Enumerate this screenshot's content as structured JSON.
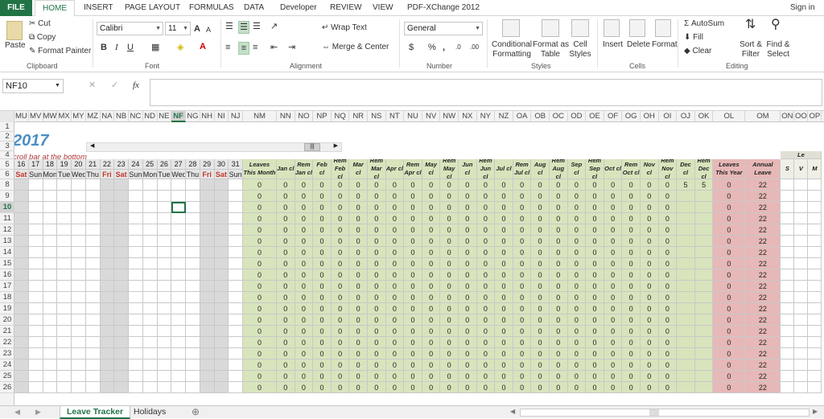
{
  "menu": {
    "tabs": [
      "FILE",
      "HOME",
      "INSERT",
      "PAGE LAYOUT",
      "FORMULAS",
      "DATA",
      "Developer",
      "REVIEW",
      "VIEW",
      "PDF-XChange 2012"
    ],
    "sign_in": "Sign in"
  },
  "ribbon": {
    "clipboard": {
      "paste": "Paste",
      "cut": "Cut",
      "copy": "Copy",
      "format_painter": "Format Painter",
      "group": "Clipboard"
    },
    "font": {
      "name": "Calibri",
      "size": "11",
      "group": "Font",
      "bold": "B",
      "italic": "I",
      "underline": "U",
      "grow": "A",
      "shrink": "A"
    },
    "alignment": {
      "wrap": "Wrap Text",
      "merge": "Merge & Center",
      "group": "Alignment"
    },
    "number": {
      "format": "General",
      "currency": "$",
      "percent": "%",
      "comma": ",",
      "group": "Number"
    },
    "styles": {
      "conditional": "Conditional",
      "conditional2": "Formatting",
      "format_table": "Format as",
      "format_table2": "Table",
      "cell_styles": "Cell",
      "cell_styles2": "Styles",
      "group": "Styles"
    },
    "cells": {
      "insert": "Insert",
      "delete": "Delete",
      "format": "Format",
      "group": "Cells"
    },
    "editing": {
      "autosum": "AutoSum",
      "fill": "Fill",
      "clear": "Clear",
      "sort": "Sort &",
      "sort2": "Filter",
      "find": "Find &",
      "find2": "Select",
      "group": "Editing"
    }
  },
  "formula_bar": {
    "name_box": "NF10",
    "fx": "fx",
    "value": ""
  },
  "columns": [
    "MU",
    "MV",
    "MW",
    "MX",
    "MY",
    "MZ",
    "NA",
    "NB",
    "NC",
    "ND",
    "NE",
    "NF",
    "NG",
    "NH",
    "NI",
    "NJ",
    "NM",
    "NN",
    "NO",
    "NP",
    "NQ",
    "NR",
    "NS",
    "NT",
    "NU",
    "NV",
    "NW",
    "NX",
    "NY",
    "NZ",
    "OA",
    "OB",
    "OC",
    "OD",
    "OE",
    "OF",
    "OG",
    "OH",
    "OI",
    "OJ",
    "OK",
    "OL",
    "OM",
    "ON",
    "OO",
    "OP"
  ],
  "active_column": "NF",
  "rows": [
    "1",
    "2",
    "3",
    "4",
    "5",
    "6",
    "8",
    "9",
    "10",
    "11",
    "12",
    "13",
    "14",
    "15",
    "16",
    "17",
    "18",
    "19",
    "20",
    "21",
    "22",
    "23",
    "24",
    "25",
    "26"
  ],
  "active_row": "10",
  "sheet": {
    "year": "2017",
    "note": "croll bar at the bottom",
    "days": [
      "16",
      "17",
      "18",
      "19",
      "20",
      "21",
      "22",
      "23",
      "24",
      "25",
      "26",
      "27",
      "28",
      "29",
      "30",
      "31"
    ],
    "weekdays": [
      "Sat",
      "Sun",
      "Mon",
      "Tue",
      "Wed",
      "Thu",
      "Fri",
      "Sat",
      "Sun",
      "Mon",
      "Tue",
      "Wed",
      "Thu",
      "Fri",
      "Sat",
      "Sun"
    ],
    "weekend_cols": [
      0,
      6,
      7,
      13,
      14
    ],
    "leave_headers": [
      "Leaves This Month",
      "Jan cl",
      "Rem Jan cl",
      "Feb cl",
      "Rem Feb cl",
      "Mar cl",
      "Rem Mar cl",
      "Apr cl",
      "Rem Apr cl",
      "May cl",
      "Rem May cl",
      "Jun cl",
      "Rem Jun cl",
      "Jul cl",
      "Rem Jul cl",
      "Aug cl",
      "Rem Aug cl",
      "Sep cl",
      "Rem Sep cl",
      "Oct cl",
      "Rem Oct cl",
      "Nov cl",
      "Rem Nov cl",
      "Dec cl",
      "Rem Dec cl"
    ],
    "red_headers": [
      "Leaves This Year",
      "Annual Leave"
    ],
    "right_headers": [
      "S",
      "V",
      "M"
    ],
    "right_top": "Le",
    "first_row": [
      "0",
      "0",
      "0",
      "0",
      "0",
      "0",
      "0",
      "0",
      "0",
      "0",
      "0",
      "0",
      "0",
      "0",
      "0",
      "0",
      "0",
      "0",
      "0",
      "0",
      "0",
      "0",
      "0",
      "5",
      "5"
    ],
    "other_rows": [
      "0",
      "0",
      "0",
      "0",
      "0",
      "0",
      "0",
      "0",
      "0",
      "0",
      "0",
      "0",
      "0",
      "0",
      "0",
      "0",
      "0",
      "0",
      "0",
      "0",
      "0",
      "0",
      "0",
      "",
      ""
    ],
    "year_val": "0",
    "annual_val": "22"
  },
  "sheet_tabs": [
    "Leave Tracker",
    "Holidays"
  ],
  "active_sheet": "Leave Tracker",
  "colors": {
    "excel_green": "#217346",
    "green_fill": "#d8e4bc",
    "red_fill": "#e6b8b7",
    "grey_fill": "#d9d9d9",
    "weekend_red": "#c0392b"
  }
}
